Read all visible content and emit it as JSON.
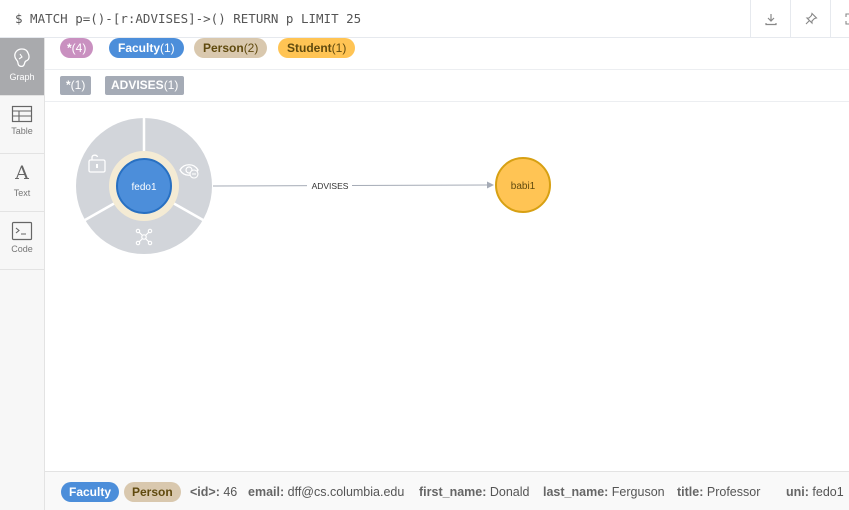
{
  "query": {
    "text": "$ MATCH p=()-[r:ADVISES]->() RETURN p LIMIT 25",
    "buttons": [
      "download-icon",
      "pin-icon",
      "expand-icon"
    ]
  },
  "sidebar": {
    "items": [
      {
        "label": "Graph",
        "icon": "graph-icon",
        "active": true
      },
      {
        "label": "Table",
        "icon": "table-icon",
        "active": false
      },
      {
        "label": "Text",
        "icon": "text-icon",
        "glyph": "A",
        "active": false
      },
      {
        "label": "Code",
        "icon": "code-icon",
        "active": false
      }
    ]
  },
  "node_labels": [
    {
      "name": "*",
      "count": "(4)",
      "color": "#c990c0"
    },
    {
      "name": "Faculty",
      "count": "(1)",
      "color": "#4c8eda"
    },
    {
      "name": "Person",
      "count": "(2)",
      "color": "#d9c8ae"
    },
    {
      "name": "Student",
      "count": "(1)",
      "color": "#ffc454"
    }
  ],
  "relationship_types": [
    {
      "name": "*",
      "count": "(1)"
    },
    {
      "name": "ADVISES",
      "count": "(1)"
    }
  ],
  "graph": {
    "nodes": [
      {
        "caption": "fedo1",
        "color": "#4c8eda",
        "stroke": "#2870c2",
        "selected": true
      },
      {
        "caption": "babi1",
        "color": "#ffc454",
        "stroke": "#d7a013",
        "selected": false
      }
    ],
    "relationship": {
      "type": "ADVISES",
      "color": "#a5abb6"
    },
    "ring_icons": [
      "unlock-icon",
      "hide-icon",
      "expand-graph-icon"
    ]
  },
  "inspector": {
    "labels": [
      {
        "name": "Faculty",
        "color": "#4c8eda",
        "text_color": "#ffffff"
      },
      {
        "name": "Person",
        "color": "#d9c8ae",
        "text_color": "#604a0e"
      }
    ],
    "properties": [
      {
        "key": "<id>:",
        "value": "46"
      },
      {
        "key": "email:",
        "value": "dff@cs.columbia.edu"
      },
      {
        "key": "first_name:",
        "value": "Donald"
      },
      {
        "key": "last_name:",
        "value": "Ferguson"
      },
      {
        "key": "title:",
        "value": "Professor"
      },
      {
        "key": "uni:",
        "value": "fedo1"
      }
    ]
  }
}
